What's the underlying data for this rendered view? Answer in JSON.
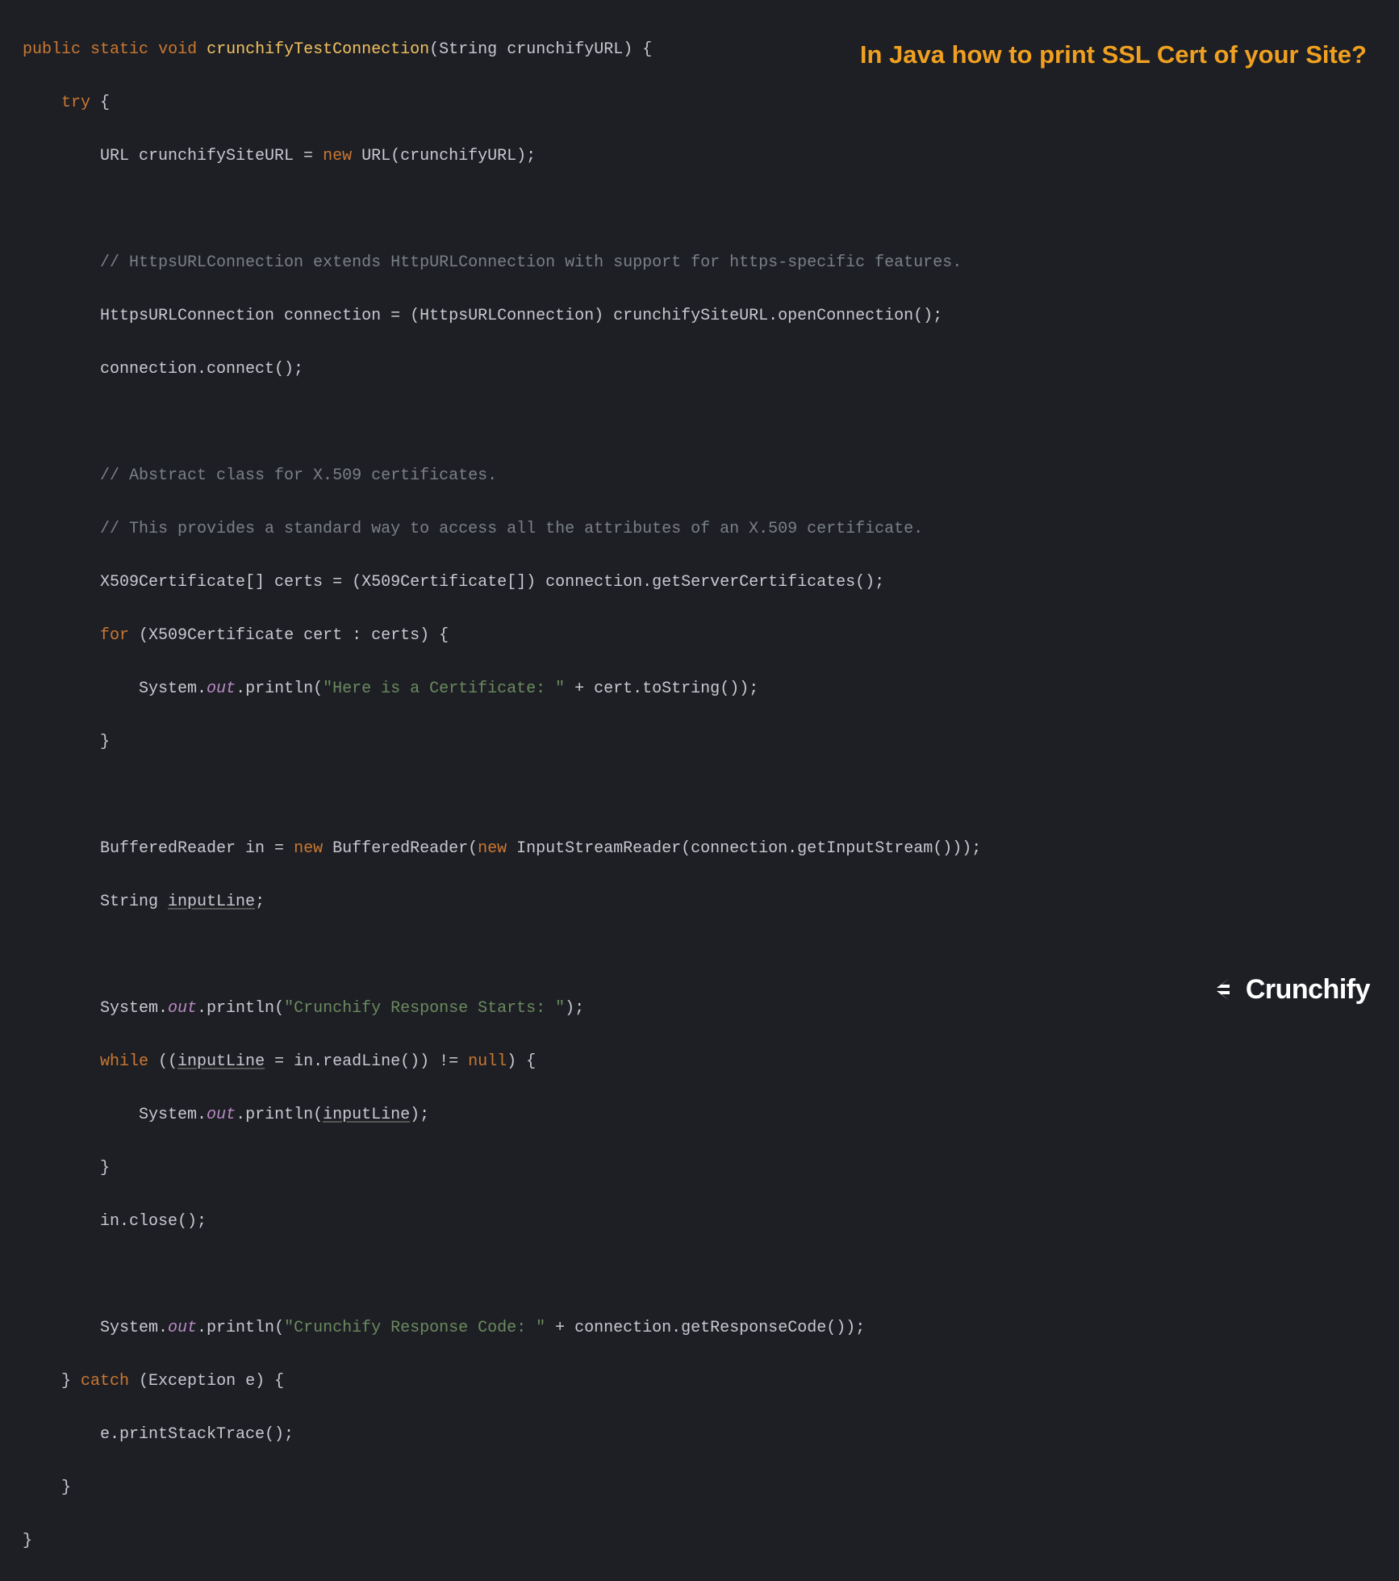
{
  "overlay_title": "In Java how to print SSL Cert of your Site?",
  "logo_text": "Crunchify",
  "code": {
    "l1_kw1": "public",
    "l1_kw2": "static",
    "l1_kw3": "void",
    "l1_fn": "crunchifyTestConnection",
    "l1_paramtype": "String",
    "l1_paramname": "crunchifyURL",
    "l2_try": "try",
    "l3_a": "URL crunchifySiteURL = ",
    "l3_new": "new",
    "l3_b": " URL(crunchifyURL);",
    "l5_comment": "// HttpsURLConnection extends HttpURLConnection with support for https-specific features.",
    "l6": "HttpsURLConnection connection = (HttpsURLConnection) crunchifySiteURL.openConnection();",
    "l7": "connection.connect();",
    "l9_comment": "// Abstract class for X.509 certificates.",
    "l10_comment": "// This provides a standard way to access all the attributes of an X.509 certificate.",
    "l11": "X509Certificate[] certs = (X509Certificate[]) connection.getServerCertificates();",
    "l12_for": "for",
    "l12_body": " (X509Certificate cert : certs) {",
    "l13_a": "System.",
    "l13_out": "out",
    "l13_b": ".println(",
    "l13_str": "\"Here is a Certificate: \"",
    "l13_c": " + cert.toString());",
    "l14": "}",
    "l16_a": "BufferedReader in = ",
    "l16_new1": "new",
    "l16_b": " BufferedReader(",
    "l16_new2": "new",
    "l16_c": " InputStreamReader(connection.getInputStream()));",
    "l17_a": "String ",
    "l17_var": "inputLine",
    "l17_b": ";",
    "l19_a": "System.",
    "l19_out": "out",
    "l19_b": ".println(",
    "l19_str": "\"Crunchify Response Starts: \"",
    "l19_c": ");",
    "l20_while": "while",
    "l20_a": " ((",
    "l20_var": "inputLine",
    "l20_b": " = in.readLine()) != ",
    "l20_null": "null",
    "l20_c": ") {",
    "l21_a": "System.",
    "l21_out": "out",
    "l21_b": ".println(",
    "l21_var": "inputLine",
    "l21_c": ");",
    "l22": "}",
    "l23": "in.close();",
    "l25_a": "System.",
    "l25_out": "out",
    "l25_b": ".println(",
    "l25_str": "\"Crunchify Response Code: \"",
    "l25_c": " + connection.getResponseCode());",
    "l26_a": "} ",
    "l26_catch": "catch",
    "l26_b": " (Exception e) {",
    "l27": "e.printStackTrace();",
    "l28": "}",
    "l29": "}"
  }
}
